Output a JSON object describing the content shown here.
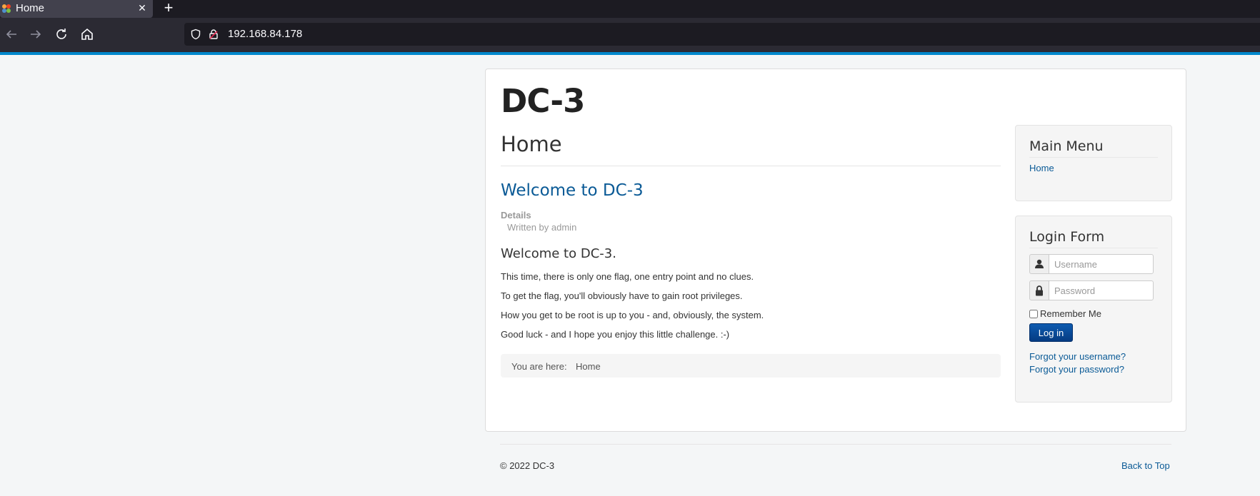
{
  "browser": {
    "tab_title": "Home",
    "tab_close": "✕",
    "new_tab": "+",
    "url": "192.168.84.178"
  },
  "page": {
    "site_title": "DC-3",
    "page_header": "Home",
    "article": {
      "title": "Welcome to DC-3",
      "details_label": "Details",
      "written_by": "Written by admin",
      "heading": "Welcome to DC-3.",
      "paragraphs": [
        "This time, there is only one flag, one entry point and no clues.",
        "To get the flag, you'll obviously have to gain root privileges.",
        "How you get to be root is up to you - and, obviously, the system.",
        "Good luck - and I hope you enjoy this little challenge.  :-)"
      ]
    },
    "breadcrumb": {
      "label": "You are here:",
      "current": "Home"
    }
  },
  "main_menu": {
    "title": "Main Menu",
    "items": [
      "Home"
    ]
  },
  "login_form": {
    "title": "Login Form",
    "username_placeholder": "Username",
    "password_placeholder": "Password",
    "remember_label": "Remember Me",
    "login_button": "Log in",
    "forgot_username": "Forgot your username?",
    "forgot_password": "Forgot your password?"
  },
  "footer": {
    "copyright": "© 2022 DC-3",
    "back_to_top": "Back to Top"
  },
  "colors": {
    "accent": "#0088cc",
    "link": "#0a5a96",
    "button": "#0e5bb0"
  }
}
